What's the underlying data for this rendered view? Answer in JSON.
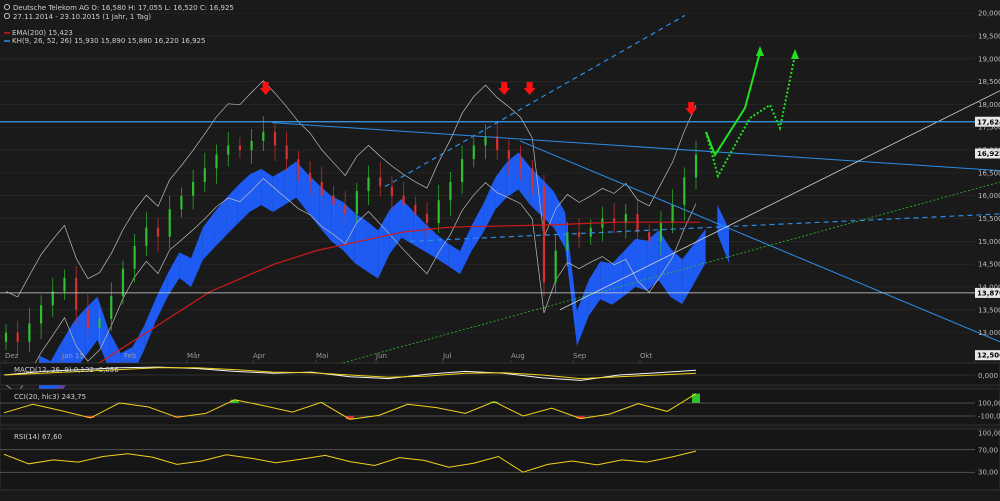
{
  "header": {
    "instrument_line": "Deutsche Telekom AG   O: 16,580  H: 17,055  L: 16,520  C: 16,925",
    "range_line": "27.11.2014 - 23.10.2015 (1 Jahr, 1 Tag)",
    "ema_label": "EMA(200) 15,423",
    "ichimoku_label": "KH(9, 26, 52, 26) 15,930  15,890  15,880  16,220  16,925"
  },
  "colors": {
    "background": "#1a1a1a",
    "grid": "#2c2c2c",
    "candle_up": "#2fbf2f",
    "candle_down": "#d63030",
    "ema": "#d01a1a",
    "kumo_bull": "#1f5fff",
    "kumo_bear": "#ff7a12",
    "trend_blue": "#2b8ee8",
    "horizontal_line": "#3a9cf0",
    "bollinger": "#bdbdbd",
    "arrow_red": "#ff1010",
    "projection_green": "#22e022",
    "oscillator": "#f2d21a"
  },
  "chart_data": [
    {
      "type": "candlestick",
      "title": "Deutsche Telekom AG",
      "x_tick_labels": [
        "Dez",
        "Jan 15",
        "Feb",
        "Mär",
        "Apr",
        "Mai",
        "Jun",
        "Jul",
        "Aug",
        "Sep",
        "Okt"
      ],
      "ylim": [
        12.4,
        20.2
      ],
      "y_ticks": [
        "20,000",
        "19,500",
        "19,000",
        "18,500",
        "18,000",
        "17,500",
        "17,000",
        "16,500",
        "16,000",
        "15,500",
        "15,000",
        "14,500",
        "14,000",
        "13,500",
        "13,000"
      ],
      "price_badges": [
        {
          "label": "17,624",
          "value": 17.62
        },
        {
          "label": "16,925",
          "value": 16.925
        },
        {
          "label": "13,870",
          "value": 13.87
        },
        {
          "label": "12,506",
          "value": 12.506
        }
      ],
      "close_approx": [
        13.0,
        12.8,
        13.2,
        13.6,
        13.9,
        14.2,
        13.5,
        13.1,
        13.3,
        13.8,
        14.4,
        14.9,
        15.3,
        15.1,
        15.7,
        16.0,
        16.3,
        16.6,
        16.9,
        17.1,
        17.0,
        17.2,
        17.4,
        17.1,
        16.8,
        16.5,
        16.3,
        16.0,
        15.8,
        15.6,
        16.1,
        16.4,
        16.2,
        16.0,
        15.8,
        15.6,
        15.4,
        15.9,
        16.3,
        16.8,
        17.1,
        17.3,
        17.0,
        16.8,
        16.6,
        16.2,
        14.1,
        14.8,
        15.2,
        15.1,
        15.3,
        15.5,
        15.4,
        15.6,
        15.2,
        15.0,
        15.4,
        15.8,
        16.4,
        16.9
      ],
      "ema200": [
        11.6,
        11.8,
        12.1,
        12.4,
        12.7,
        13.0,
        13.3,
        13.6,
        13.9,
        14.1,
        14.3,
        14.5,
        14.65,
        14.8,
        14.9,
        15.0,
        15.1,
        15.2,
        15.25,
        15.3,
        15.32,
        15.33,
        15.34,
        15.35,
        15.36,
        15.38,
        15.4,
        15.42,
        15.42,
        15.42,
        15.42,
        15.42
      ],
      "markers": [
        {
          "type": "down-arrow",
          "month_index": 4.2
        },
        {
          "type": "down-arrow",
          "month_index": 7.9
        },
        {
          "type": "down-arrow",
          "month_index": 8.3
        },
        {
          "type": "down-arrow",
          "month_index": 10.8
        }
      ]
    },
    {
      "type": "line",
      "title": "MACD(12, 26, 9) 0,132 -0,056",
      "series": [
        {
          "name": "MACD",
          "values": [
            0.0,
            0.1,
            0.15,
            0.2,
            0.22,
            0.18,
            0.1,
            0.05,
            0.08,
            -0.05,
            -0.1,
            0.02,
            0.1,
            0.05,
            -0.08,
            -0.15,
            0.0,
            0.06,
            0.13
          ]
        },
        {
          "name": "Signal",
          "values": [
            0.0,
            0.05,
            0.1,
            0.15,
            0.2,
            0.2,
            0.15,
            0.08,
            0.06,
            0.0,
            -0.06,
            -0.03,
            0.05,
            0.06,
            0.0,
            -0.1,
            -0.05,
            0.0,
            0.05
          ]
        }
      ],
      "y_ticks": [
        "0,000"
      ]
    },
    {
      "type": "line",
      "title": "CCI(20, hlc3) 243,75",
      "series": [
        {
          "name": "CCI",
          "values": [
            -50,
            80,
            -20,
            -130,
            100,
            40,
            -120,
            -60,
            150,
            60,
            -40,
            110,
            -150,
            -90,
            80,
            30,
            -60,
            120,
            -100,
            20,
            -140,
            -70,
            90,
            -30,
            243.75
          ]
        }
      ],
      "y_ticks": [
        "100,00",
        "-100,00"
      ]
    },
    {
      "type": "line",
      "title": "RSI(14) 67,60",
      "series": [
        {
          "name": "RSI",
          "values": [
            62,
            45,
            52,
            48,
            58,
            63,
            57,
            44,
            50,
            61,
            55,
            47,
            53,
            60,
            49,
            42,
            56,
            51,
            39,
            46,
            58,
            30,
            44,
            50,
            43,
            52,
            48,
            57,
            67.6
          ]
        }
      ],
      "y_ticks": [
        "100,00",
        "70,00",
        "30,00"
      ]
    }
  ]
}
